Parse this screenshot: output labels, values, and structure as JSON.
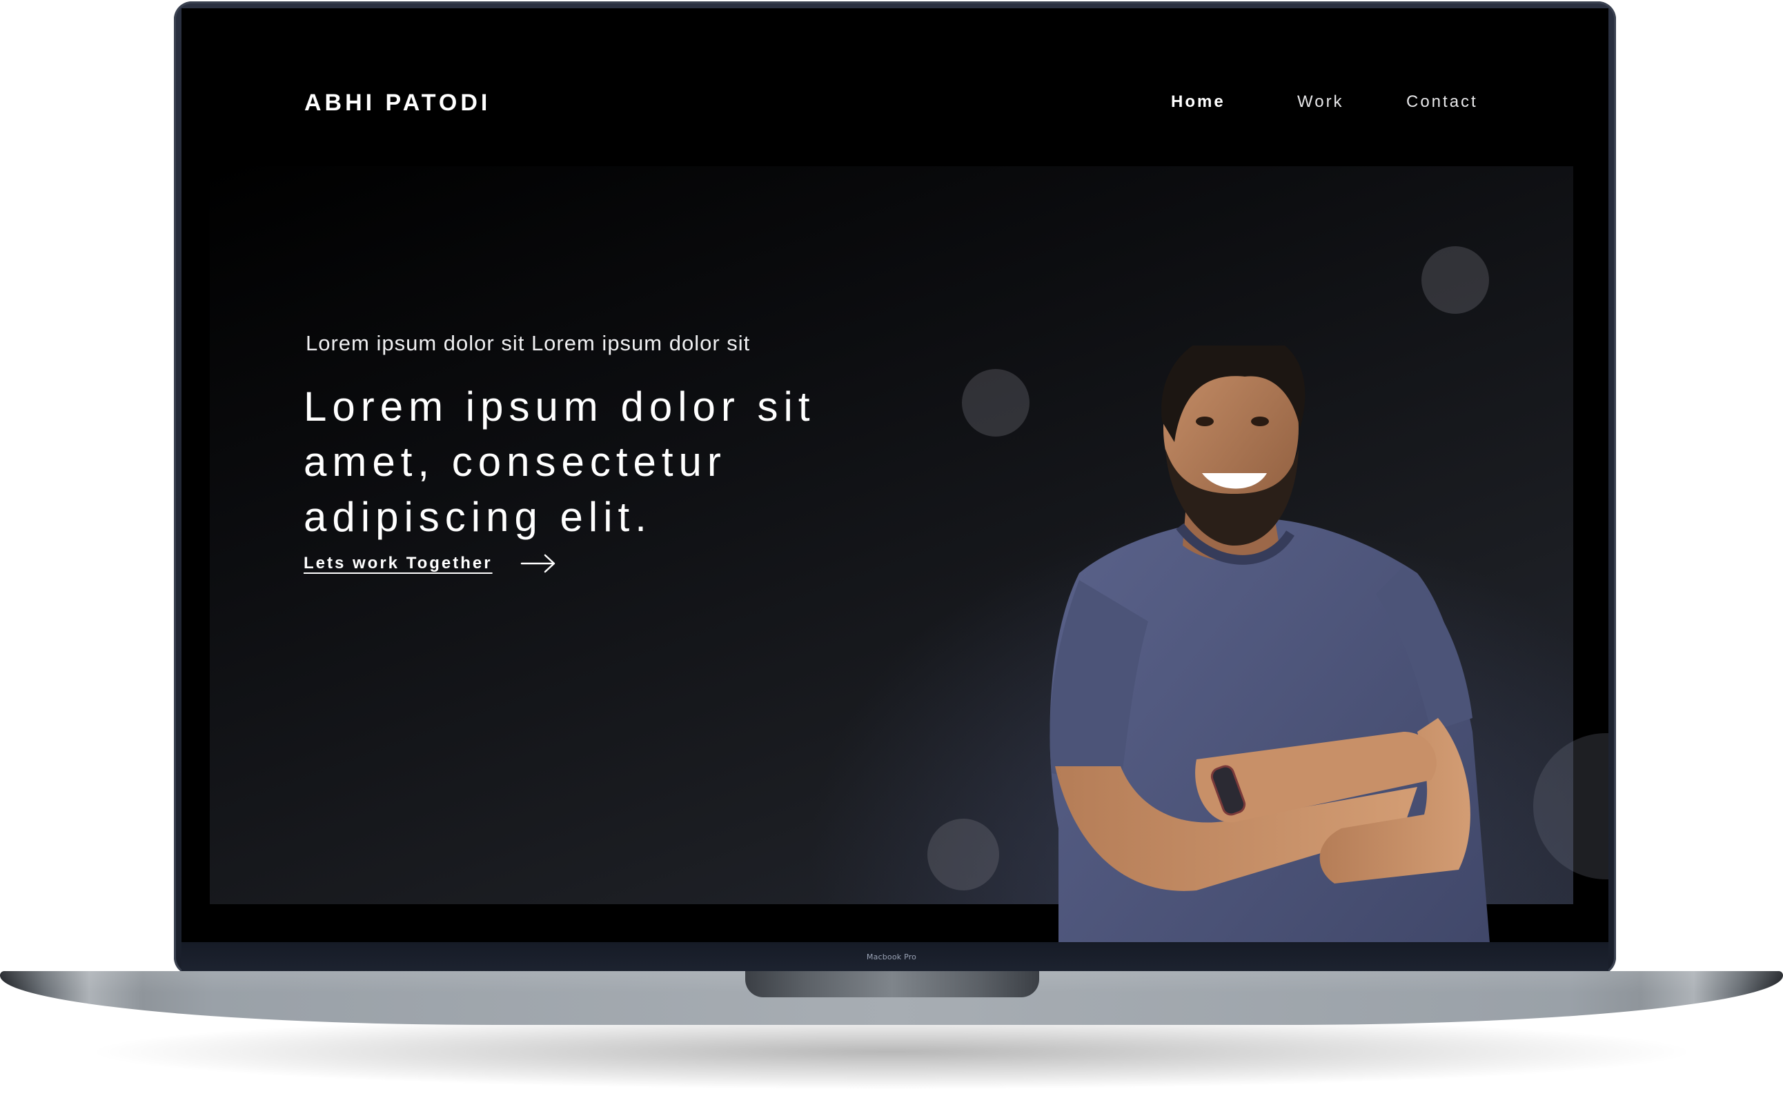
{
  "device": {
    "label": "Macbook Pro"
  },
  "site": {
    "brand": "ABHI PATODI",
    "nav": [
      {
        "label": "Home",
        "active": true
      },
      {
        "label": "Work",
        "active": false
      },
      {
        "label": "Contact",
        "active": false
      }
    ]
  },
  "hero": {
    "eyebrow": "Lorem ipsum dolor sit Lorem ipsum dolor sit",
    "headline_lines": [
      "Lorem ipsum dolor sit",
      "amet, consectetur",
      "adipiscing elit."
    ],
    "cta_label": "Lets work Together",
    "cta_icon": "arrow-right-icon",
    "portrait": "smiling-man-arms-crossed-photo"
  },
  "colors": {
    "background": "#000000",
    "text": "#ffffff",
    "shirt": "#4a5278",
    "bubble": "#5a5c66"
  }
}
